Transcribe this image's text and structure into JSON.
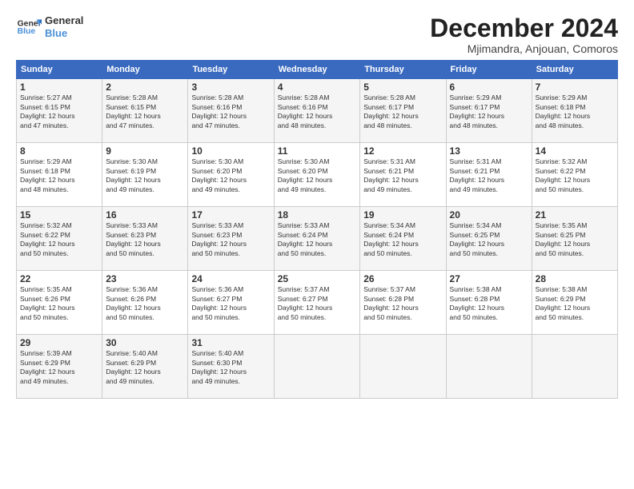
{
  "header": {
    "logo_line1": "General",
    "logo_line2": "Blue",
    "title": "December 2024",
    "location": "Mjimandra, Anjouan, Comoros"
  },
  "weekdays": [
    "Sunday",
    "Monday",
    "Tuesday",
    "Wednesday",
    "Thursday",
    "Friday",
    "Saturday"
  ],
  "weeks": [
    [
      {
        "day": "1",
        "sunrise": "5:27 AM",
        "sunset": "6:15 PM",
        "daylight": "12 hours and 47 minutes."
      },
      {
        "day": "2",
        "sunrise": "5:28 AM",
        "sunset": "6:15 PM",
        "daylight": "12 hours and 47 minutes."
      },
      {
        "day": "3",
        "sunrise": "5:28 AM",
        "sunset": "6:16 PM",
        "daylight": "12 hours and 47 minutes."
      },
      {
        "day": "4",
        "sunrise": "5:28 AM",
        "sunset": "6:16 PM",
        "daylight": "12 hours and 48 minutes."
      },
      {
        "day": "5",
        "sunrise": "5:28 AM",
        "sunset": "6:17 PM",
        "daylight": "12 hours and 48 minutes."
      },
      {
        "day": "6",
        "sunrise": "5:29 AM",
        "sunset": "6:17 PM",
        "daylight": "12 hours and 48 minutes."
      },
      {
        "day": "7",
        "sunrise": "5:29 AM",
        "sunset": "6:18 PM",
        "daylight": "12 hours and 48 minutes."
      }
    ],
    [
      {
        "day": "8",
        "sunrise": "5:29 AM",
        "sunset": "6:18 PM",
        "daylight": "12 hours and 48 minutes."
      },
      {
        "day": "9",
        "sunrise": "5:30 AM",
        "sunset": "6:19 PM",
        "daylight": "12 hours and 49 minutes."
      },
      {
        "day": "10",
        "sunrise": "5:30 AM",
        "sunset": "6:20 PM",
        "daylight": "12 hours and 49 minutes."
      },
      {
        "day": "11",
        "sunrise": "5:30 AM",
        "sunset": "6:20 PM",
        "daylight": "12 hours and 49 minutes."
      },
      {
        "day": "12",
        "sunrise": "5:31 AM",
        "sunset": "6:21 PM",
        "daylight": "12 hours and 49 minutes."
      },
      {
        "day": "13",
        "sunrise": "5:31 AM",
        "sunset": "6:21 PM",
        "daylight": "12 hours and 49 minutes."
      },
      {
        "day": "14",
        "sunrise": "5:32 AM",
        "sunset": "6:22 PM",
        "daylight": "12 hours and 50 minutes."
      }
    ],
    [
      {
        "day": "15",
        "sunrise": "5:32 AM",
        "sunset": "6:22 PM",
        "daylight": "12 hours and 50 minutes."
      },
      {
        "day": "16",
        "sunrise": "5:33 AM",
        "sunset": "6:23 PM",
        "daylight": "12 hours and 50 minutes."
      },
      {
        "day": "17",
        "sunrise": "5:33 AM",
        "sunset": "6:23 PM",
        "daylight": "12 hours and 50 minutes."
      },
      {
        "day": "18",
        "sunrise": "5:33 AM",
        "sunset": "6:24 PM",
        "daylight": "12 hours and 50 minutes."
      },
      {
        "day": "19",
        "sunrise": "5:34 AM",
        "sunset": "6:24 PM",
        "daylight": "12 hours and 50 minutes."
      },
      {
        "day": "20",
        "sunrise": "5:34 AM",
        "sunset": "6:25 PM",
        "daylight": "12 hours and 50 minutes."
      },
      {
        "day": "21",
        "sunrise": "5:35 AM",
        "sunset": "6:25 PM",
        "daylight": "12 hours and 50 minutes."
      }
    ],
    [
      {
        "day": "22",
        "sunrise": "5:35 AM",
        "sunset": "6:26 PM",
        "daylight": "12 hours and 50 minutes."
      },
      {
        "day": "23",
        "sunrise": "5:36 AM",
        "sunset": "6:26 PM",
        "daylight": "12 hours and 50 minutes."
      },
      {
        "day": "24",
        "sunrise": "5:36 AM",
        "sunset": "6:27 PM",
        "daylight": "12 hours and 50 minutes."
      },
      {
        "day": "25",
        "sunrise": "5:37 AM",
        "sunset": "6:27 PM",
        "daylight": "12 hours and 50 minutes."
      },
      {
        "day": "26",
        "sunrise": "5:37 AM",
        "sunset": "6:28 PM",
        "daylight": "12 hours and 50 minutes."
      },
      {
        "day": "27",
        "sunrise": "5:38 AM",
        "sunset": "6:28 PM",
        "daylight": "12 hours and 50 minutes."
      },
      {
        "day": "28",
        "sunrise": "5:38 AM",
        "sunset": "6:29 PM",
        "daylight": "12 hours and 50 minutes."
      }
    ],
    [
      {
        "day": "29",
        "sunrise": "5:39 AM",
        "sunset": "6:29 PM",
        "daylight": "12 hours and 49 minutes."
      },
      {
        "day": "30",
        "sunrise": "5:40 AM",
        "sunset": "6:29 PM",
        "daylight": "12 hours and 49 minutes."
      },
      {
        "day": "31",
        "sunrise": "5:40 AM",
        "sunset": "6:30 PM",
        "daylight": "12 hours and 49 minutes."
      },
      null,
      null,
      null,
      null
    ]
  ],
  "labels": {
    "sunrise": "Sunrise:",
    "sunset": "Sunset:",
    "daylight": "Daylight:"
  }
}
